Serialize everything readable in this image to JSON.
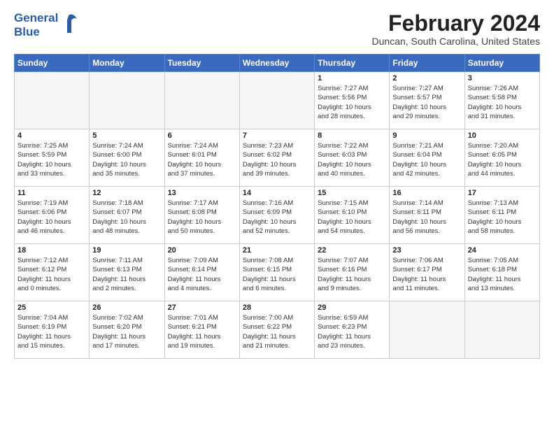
{
  "logo": {
    "line1": "General",
    "line2": "Blue"
  },
  "title": "February 2024",
  "subtitle": "Duncan, South Carolina, United States",
  "headers": [
    "Sunday",
    "Monday",
    "Tuesday",
    "Wednesday",
    "Thursday",
    "Friday",
    "Saturday"
  ],
  "weeks": [
    [
      {
        "day": "",
        "detail": ""
      },
      {
        "day": "",
        "detail": ""
      },
      {
        "day": "",
        "detail": ""
      },
      {
        "day": "",
        "detail": ""
      },
      {
        "day": "1",
        "detail": "Sunrise: 7:27 AM\nSunset: 5:56 PM\nDaylight: 10 hours\nand 28 minutes."
      },
      {
        "day": "2",
        "detail": "Sunrise: 7:27 AM\nSunset: 5:57 PM\nDaylight: 10 hours\nand 29 minutes."
      },
      {
        "day": "3",
        "detail": "Sunrise: 7:26 AM\nSunset: 5:58 PM\nDaylight: 10 hours\nand 31 minutes."
      }
    ],
    [
      {
        "day": "4",
        "detail": "Sunrise: 7:25 AM\nSunset: 5:59 PM\nDaylight: 10 hours\nand 33 minutes."
      },
      {
        "day": "5",
        "detail": "Sunrise: 7:24 AM\nSunset: 6:00 PM\nDaylight: 10 hours\nand 35 minutes."
      },
      {
        "day": "6",
        "detail": "Sunrise: 7:24 AM\nSunset: 6:01 PM\nDaylight: 10 hours\nand 37 minutes."
      },
      {
        "day": "7",
        "detail": "Sunrise: 7:23 AM\nSunset: 6:02 PM\nDaylight: 10 hours\nand 39 minutes."
      },
      {
        "day": "8",
        "detail": "Sunrise: 7:22 AM\nSunset: 6:03 PM\nDaylight: 10 hours\nand 40 minutes."
      },
      {
        "day": "9",
        "detail": "Sunrise: 7:21 AM\nSunset: 6:04 PM\nDaylight: 10 hours\nand 42 minutes."
      },
      {
        "day": "10",
        "detail": "Sunrise: 7:20 AM\nSunset: 6:05 PM\nDaylight: 10 hours\nand 44 minutes."
      }
    ],
    [
      {
        "day": "11",
        "detail": "Sunrise: 7:19 AM\nSunset: 6:06 PM\nDaylight: 10 hours\nand 46 minutes."
      },
      {
        "day": "12",
        "detail": "Sunrise: 7:18 AM\nSunset: 6:07 PM\nDaylight: 10 hours\nand 48 minutes."
      },
      {
        "day": "13",
        "detail": "Sunrise: 7:17 AM\nSunset: 6:08 PM\nDaylight: 10 hours\nand 50 minutes."
      },
      {
        "day": "14",
        "detail": "Sunrise: 7:16 AM\nSunset: 6:09 PM\nDaylight: 10 hours\nand 52 minutes."
      },
      {
        "day": "15",
        "detail": "Sunrise: 7:15 AM\nSunset: 6:10 PM\nDaylight: 10 hours\nand 54 minutes."
      },
      {
        "day": "16",
        "detail": "Sunrise: 7:14 AM\nSunset: 6:11 PM\nDaylight: 10 hours\nand 56 minutes."
      },
      {
        "day": "17",
        "detail": "Sunrise: 7:13 AM\nSunset: 6:11 PM\nDaylight: 10 hours\nand 58 minutes."
      }
    ],
    [
      {
        "day": "18",
        "detail": "Sunrise: 7:12 AM\nSunset: 6:12 PM\nDaylight: 11 hours\nand 0 minutes."
      },
      {
        "day": "19",
        "detail": "Sunrise: 7:11 AM\nSunset: 6:13 PM\nDaylight: 11 hours\nand 2 minutes."
      },
      {
        "day": "20",
        "detail": "Sunrise: 7:09 AM\nSunset: 6:14 PM\nDaylight: 11 hours\nand 4 minutes."
      },
      {
        "day": "21",
        "detail": "Sunrise: 7:08 AM\nSunset: 6:15 PM\nDaylight: 11 hours\nand 6 minutes."
      },
      {
        "day": "22",
        "detail": "Sunrise: 7:07 AM\nSunset: 6:16 PM\nDaylight: 11 hours\nand 9 minutes."
      },
      {
        "day": "23",
        "detail": "Sunrise: 7:06 AM\nSunset: 6:17 PM\nDaylight: 11 hours\nand 11 minutes."
      },
      {
        "day": "24",
        "detail": "Sunrise: 7:05 AM\nSunset: 6:18 PM\nDaylight: 11 hours\nand 13 minutes."
      }
    ],
    [
      {
        "day": "25",
        "detail": "Sunrise: 7:04 AM\nSunset: 6:19 PM\nDaylight: 11 hours\nand 15 minutes."
      },
      {
        "day": "26",
        "detail": "Sunrise: 7:02 AM\nSunset: 6:20 PM\nDaylight: 11 hours\nand 17 minutes."
      },
      {
        "day": "27",
        "detail": "Sunrise: 7:01 AM\nSunset: 6:21 PM\nDaylight: 11 hours\nand 19 minutes."
      },
      {
        "day": "28",
        "detail": "Sunrise: 7:00 AM\nSunset: 6:22 PM\nDaylight: 11 hours\nand 21 minutes."
      },
      {
        "day": "29",
        "detail": "Sunrise: 6:59 AM\nSunset: 6:23 PM\nDaylight: 11 hours\nand 23 minutes."
      },
      {
        "day": "",
        "detail": ""
      },
      {
        "day": "",
        "detail": ""
      }
    ]
  ]
}
